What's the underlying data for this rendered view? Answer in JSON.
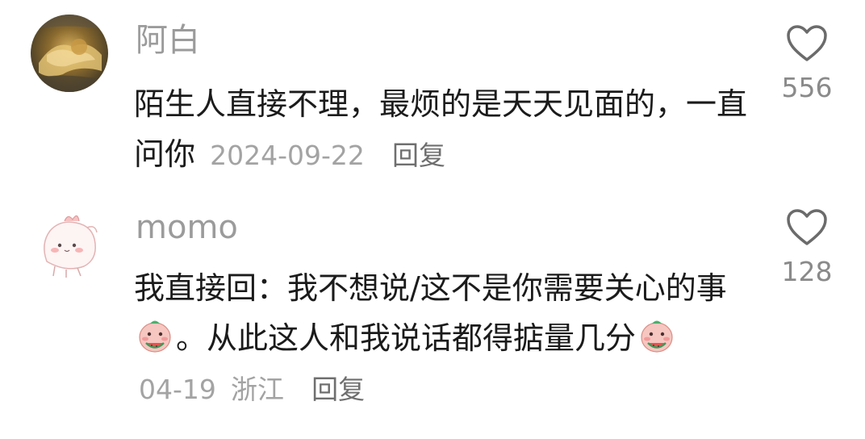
{
  "comments": [
    {
      "username": "阿白",
      "text": "陌生人直接不理，最烦的是天天见面的，一直问你",
      "date": "2024-09-22",
      "location": "",
      "reply_label": "回复",
      "likes": "556",
      "avatar_icon": "golden-lion-avatar",
      "like_icon": "heart-outline-icon"
    },
    {
      "username": "momo",
      "text_part1": "我直接回：我不想说/这不是你需要关心的事",
      "text_part2": "。从此这人和我说话都得掂量几分",
      "date": "04-19",
      "location": "浙江",
      "reply_label": "回复",
      "likes": "128",
      "avatar_icon": "pink-blob-character-avatar",
      "emoji_icon": "watermelon-eating-emoji",
      "like_icon": "heart-outline-icon"
    }
  ],
  "colors": {
    "username": "#9b9b9b",
    "body_text": "#1b1b1b",
    "meta": "#a3a3a3",
    "reply": "#6f6f6f",
    "like_icon": "#6b6b6b"
  }
}
